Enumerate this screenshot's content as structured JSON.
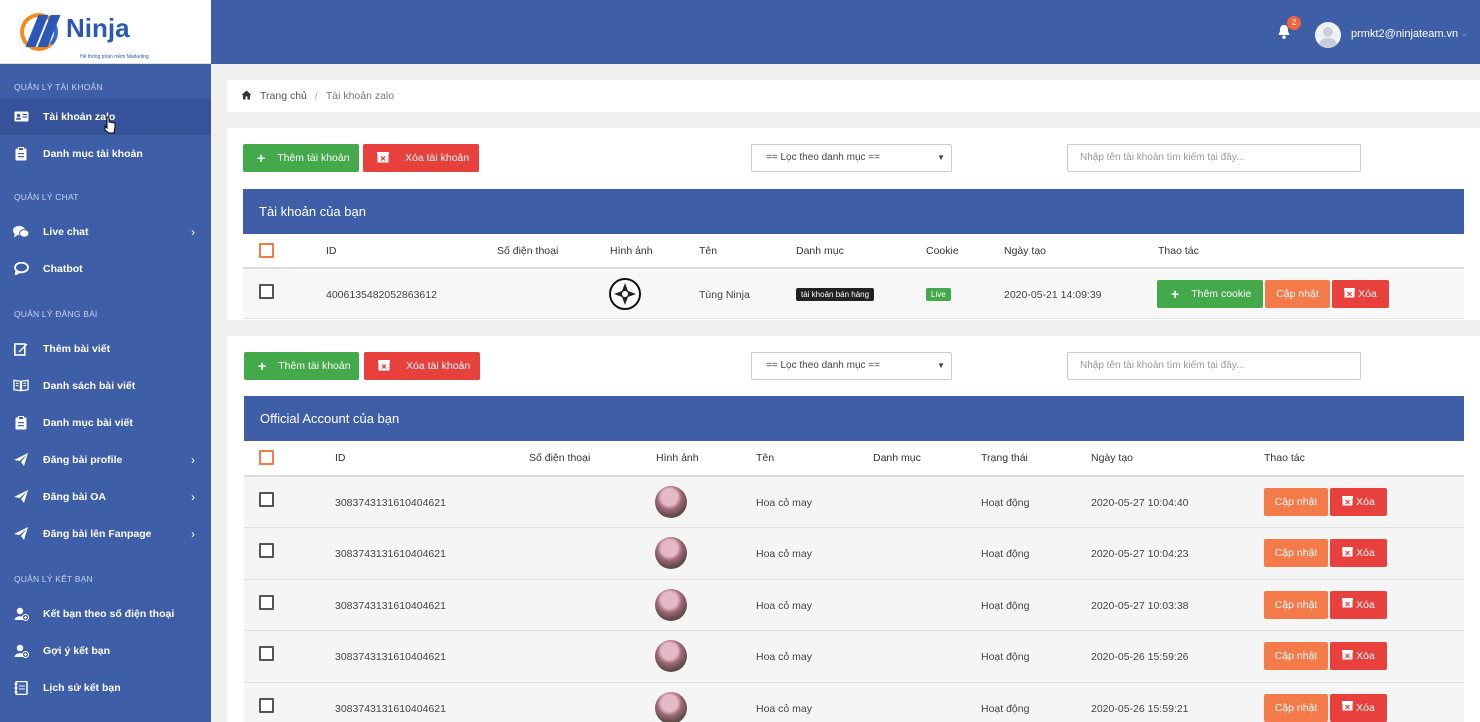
{
  "sidebar": {
    "logo": {
      "text": "Ninja",
      "tagline": "Hệ thống phần mềm Marketing"
    },
    "sections": [
      {
        "title": "QUẢN LÝ TÀI KHOẢN",
        "items": [
          {
            "label": "Tài khoản zalo",
            "icon": "id-card-icon",
            "active": true
          },
          {
            "label": "Danh mục tài khoản",
            "icon": "clipboard-icon"
          }
        ]
      },
      {
        "title": "QUẢN LÝ CHAT",
        "items": [
          {
            "label": "Live chat",
            "icon": "chat-bubbles-icon",
            "chevron": true
          },
          {
            "label": "Chatbot",
            "icon": "chat-bubble-icon"
          }
        ]
      },
      {
        "title": "QUẢN LÝ ĐĂNG BÀI",
        "items": [
          {
            "label": "Thêm bài viết",
            "icon": "edit-icon"
          },
          {
            "label": "Danh sách bài viết",
            "icon": "book-icon"
          },
          {
            "label": "Danh mục bài viết",
            "icon": "clipboard-icon"
          },
          {
            "label": "Đăng bài profile",
            "icon": "send-icon",
            "chevron": true
          },
          {
            "label": "Đăng bài OA",
            "icon": "send-icon",
            "chevron": true
          },
          {
            "label": "Đăng bài lên Fanpage",
            "icon": "send-icon",
            "chevron": true
          }
        ]
      },
      {
        "title": "QUẢN LÝ KẾT BẠN",
        "items": [
          {
            "label": "Kết bạn theo số điện thoại",
            "icon": "user-add-icon"
          },
          {
            "label": "Gợi ý kết bạn",
            "icon": "user-add-icon"
          },
          {
            "label": "Lịch sử kết bạn",
            "icon": "address-book-icon"
          }
        ]
      }
    ]
  },
  "header": {
    "notification_count": "2",
    "user_email": "prmkt2@ninjateam.vn",
    "chevron": "⌄"
  },
  "breadcrumb": {
    "home": "Trang chủ",
    "separator": "/",
    "current": "Tài khoản zalo"
  },
  "panel1": {
    "add_button": "Thêm tài khoản",
    "delete_button": "Xóa tài khoản",
    "filter_select": "== Lọc theo danh mục ==",
    "search_placeholder": "Nhập tên tài khoản tìm kiếm tại đây...",
    "table_title": "Tài khoản của bạn",
    "columns": [
      "ID",
      "Số điện thoại",
      "Hình ảnh",
      "Tên",
      "Danh mục",
      "Cookie",
      "Ngày tạo",
      "Thao tác"
    ],
    "rows": [
      {
        "id": "4006135482052863612",
        "phone": "",
        "name": "Tùng Ninja",
        "category": "tài khoản bán hàng",
        "cookie": "Live",
        "created": "2020-05-21 14:09:39",
        "add_cookie": "Thêm cookie",
        "update": "Cập nhật",
        "delete": "Xóa"
      }
    ]
  },
  "panel2": {
    "add_button": "Thêm tài khoản",
    "delete_button": "Xóa tài khoản",
    "filter_select": "== Lọc theo danh mục ==",
    "search_placeholder": "Nhập tên tài khoản tìm kiếm tại đây...",
    "table_title": "Official Account của bạn",
    "columns": [
      "ID",
      "Số điện thoại",
      "Hình ảnh",
      "Tên",
      "Danh mục",
      "Trạng thái",
      "Ngày tạo",
      "Thao tác"
    ],
    "rows": [
      {
        "id": "3083743131610404621",
        "name": "Hoa cỏ may",
        "status": "Hoạt động",
        "created": "2020-05-27 10:04:40",
        "update": "Cập nhật",
        "delete": "Xóa"
      },
      {
        "id": "3083743131610404621",
        "name": "Hoa cỏ may",
        "status": "Hoạt động",
        "created": "2020-05-27 10:04:23",
        "update": "Cập nhật",
        "delete": "Xóa"
      },
      {
        "id": "3083743131610404621",
        "name": "Hoa cỏ may",
        "status": "Hoạt động",
        "created": "2020-05-27 10:03:38",
        "update": "Cập nhật",
        "delete": "Xóa"
      },
      {
        "id": "3083743131610404621",
        "name": "Hoa cỏ may",
        "status": "Hoạt động",
        "created": "2020-05-26 15:59:26",
        "update": "Cập nhật",
        "delete": "Xóa"
      },
      {
        "id": "3083743131610404621",
        "name": "Hoa cỏ may",
        "status": "Hoạt động",
        "created": "2020-05-26 15:59:21",
        "update": "Cập nhật",
        "delete": "Xóa"
      }
    ]
  },
  "colors": {
    "primary": "#3f5ea8",
    "green": "#43a94a",
    "red": "#e8403c",
    "orange": "#f47a4a"
  }
}
